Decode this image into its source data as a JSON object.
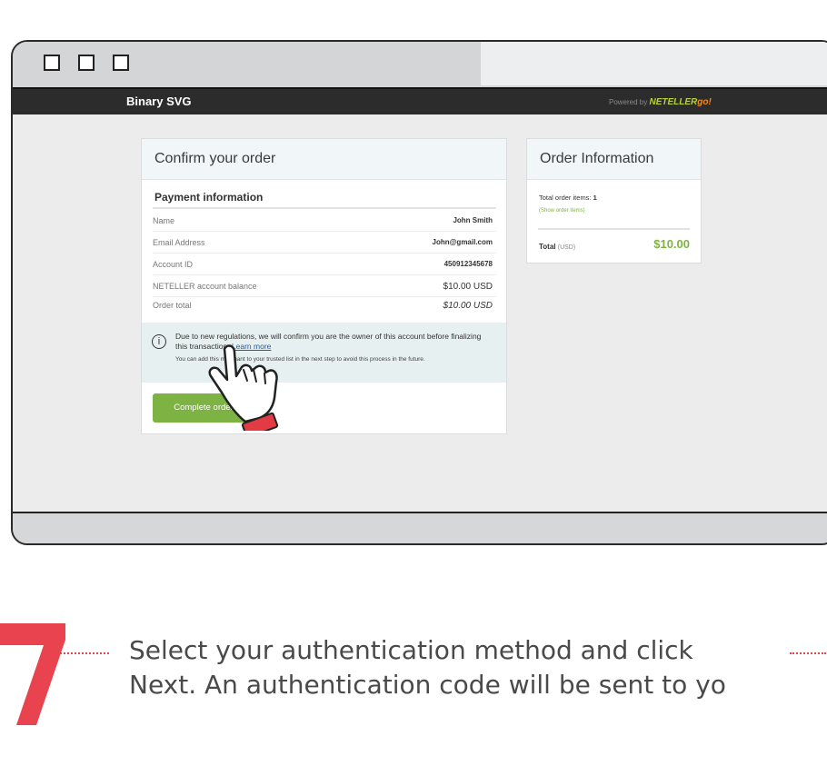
{
  "browser": {
    "brand": "Binary SVG",
    "powered_by": "Powered by",
    "powered_brand": "NETELLER",
    "powered_go": "go!"
  },
  "confirm": {
    "title": "Confirm your order",
    "payment_title": "Payment information",
    "rows": [
      {
        "label": "Name",
        "value": "John Smith"
      },
      {
        "label": "Email Address",
        "value": "John@gmail.com"
      },
      {
        "label": "Account ID",
        "value": "450912345678"
      },
      {
        "label": "NETELLER account balance",
        "value": "$10.00 USD"
      },
      {
        "label": "Order total",
        "value": "$10.00 USD"
      }
    ],
    "notice_text": "Due to new regulations, we will confirm you are the owner of this account before finalizing this transaction.",
    "notice_link": "Learn more",
    "notice_sub": "You can add this merchant to your trusted list in the next step to avoid this process in the future.",
    "button": "Complete order"
  },
  "order_info": {
    "title": "Order Information",
    "items_label": "Total order items:",
    "items_count": "1",
    "show_items": "(Show order items)",
    "total_label": "Total",
    "total_currency": "(USD)",
    "total_value": "$10.00"
  },
  "step": {
    "number": "7",
    "line1": "Select your authentication method and click",
    "line2": "Next. An authentication code will be sent to yo"
  },
  "colors": {
    "accent_green": "#7cb342",
    "step_red": "#e8434f",
    "navbar": "#2c2c2c"
  }
}
